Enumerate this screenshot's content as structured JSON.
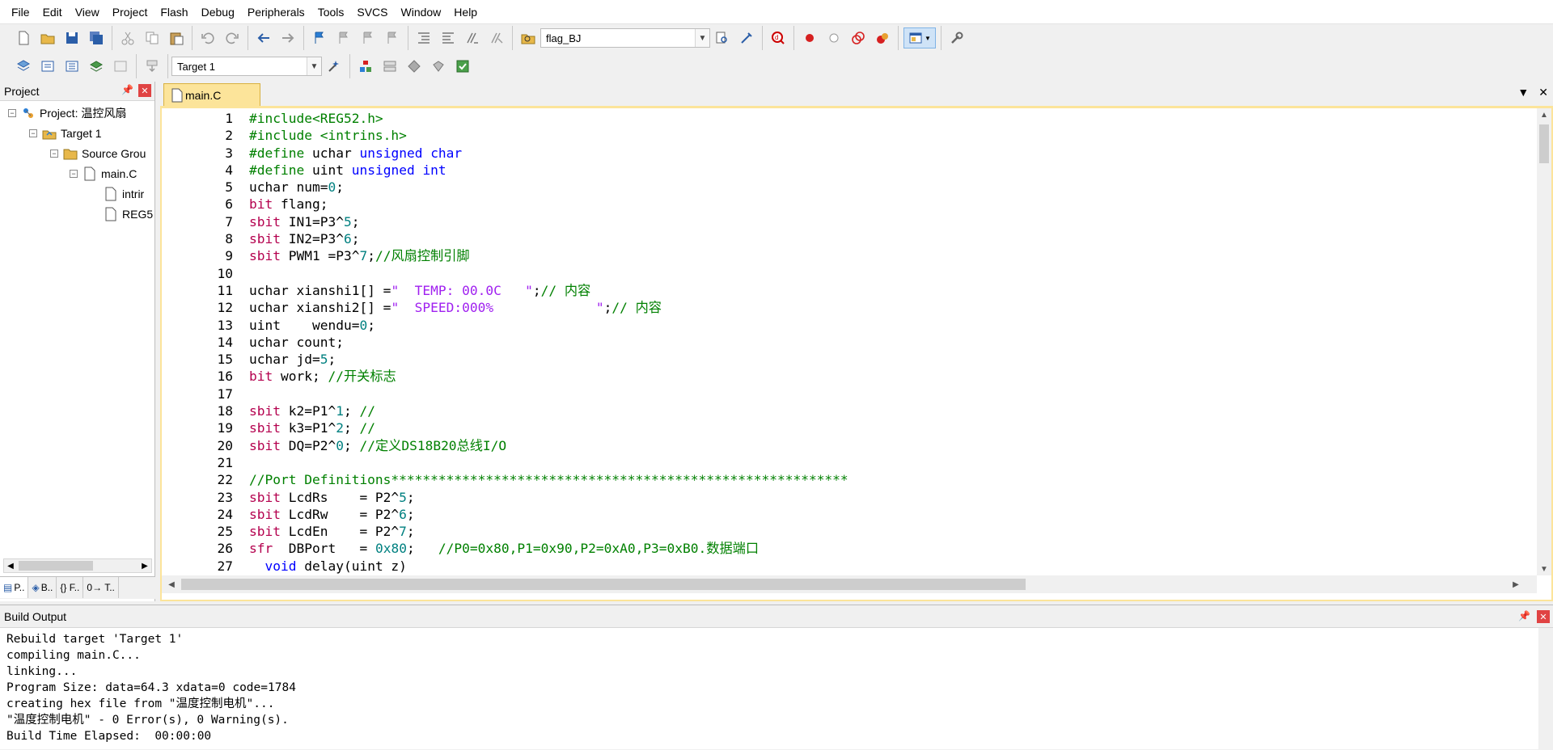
{
  "menu": [
    "File",
    "Edit",
    "View",
    "Project",
    "Flash",
    "Debug",
    "Peripherals",
    "Tools",
    "SVCS",
    "Window",
    "Help"
  ],
  "toolbar": {
    "find_combo_value": "flag_BJ",
    "target_combo_value": "Target 1"
  },
  "project_panel": {
    "title": "Project",
    "tree": [
      {
        "label": "Project: 温控风扇",
        "level": 0,
        "icon": "project-icon"
      },
      {
        "label": "Target 1",
        "level": 1,
        "icon": "target-icon"
      },
      {
        "label": "Source Grou",
        "level": 2,
        "icon": "folder-icon"
      },
      {
        "label": "main.C",
        "level": 3,
        "icon": "file-icon"
      },
      {
        "label": "intrir",
        "level": 4,
        "icon": "header-file-icon"
      },
      {
        "label": "REG5",
        "level": 4,
        "icon": "header-file-icon"
      }
    ],
    "tabs": [
      "P..",
      "B..",
      "{} F..",
      "0→ T.."
    ]
  },
  "editor": {
    "active_tab": "main.C",
    "line_numbers": [
      "1",
      "2",
      "3",
      "4",
      "5",
      "6",
      "7",
      "8",
      "9",
      "10",
      "11",
      "12",
      "13",
      "14",
      "15",
      "16",
      "17",
      "18",
      "19",
      "20",
      "21",
      "22",
      "23",
      "24",
      "25",
      "26",
      "27"
    ],
    "lines": [
      "#include<REG52.h>",
      "#include <intrins.h>",
      "#define uchar unsigned char",
      "#define uint unsigned int",
      "uchar num=0;",
      "bit flang;",
      "sbit IN1=P3^5;",
      "sbit IN2=P3^6;",
      "sbit PWM1 =P3^7;//风扇控制引脚",
      "",
      "uchar xianshi1[] =\"  TEMP: 00.0C   \";// 内容",
      "uchar xianshi2[] =\"  SPEED:000%             \";// 内容",
      "uint    wendu=0;",
      "uchar count;",
      "uchar jd=5;",
      "bit work; //开关标志",
      "",
      "sbit k2=P1^1; //",
      "sbit k3=P1^2; //",
      "sbit DQ=P2^0; //定义DS18B20总线I/O",
      "",
      "//Port Definitions**********************************************************",
      "sbit LcdRs    = P2^5;",
      "sbit LcdRw    = P2^6;",
      "sbit LcdEn    = P2^7;",
      "sfr  DBPort   = 0x80;   //P0=0x80,P1=0x90,P2=0xA0,P3=0xB0.数据端口",
      "  void delay(uint z)"
    ]
  },
  "build_output": {
    "title": "Build Output",
    "lines": [
      "Rebuild target 'Target 1'",
      "compiling main.C...",
      "linking...",
      "Program Size: data=64.3 xdata=0 code=1784",
      "creating hex file from \"温度控制电机\"...",
      "\"温度控制电机\" - 0 Error(s), 0 Warning(s).",
      "Build Time Elapsed:  00:00:00"
    ]
  }
}
